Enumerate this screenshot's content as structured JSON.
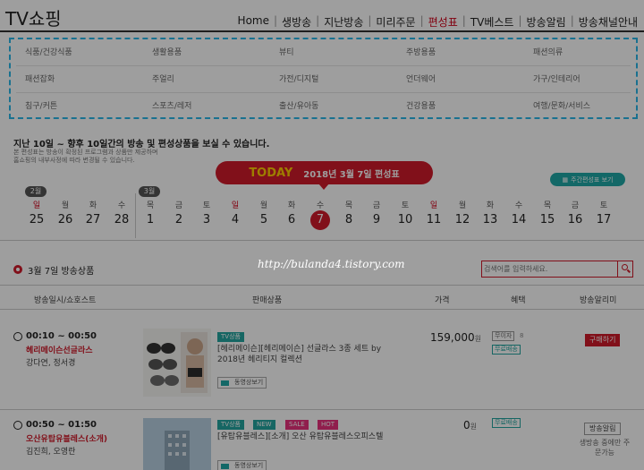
{
  "header": {
    "title": "TV쇼핑",
    "nav": [
      "Home",
      "생방송",
      "지난방송",
      "미리주문",
      "편성표",
      "TV베스트",
      "방송알림",
      "방송채널안내"
    ],
    "active_nav": "편성표"
  },
  "categories": [
    [
      "식품/건강식품",
      "생활용품",
      "뷰티",
      "주방용품",
      "패션의류"
    ],
    [
      "패션잡화",
      "주얼리",
      "가전/디지털",
      "언더웨어",
      "가구/인테리어"
    ],
    [
      "침구/커튼",
      "스포츠/레저",
      "출산/유아동",
      "건강용품",
      "여행/문화/서비스"
    ]
  ],
  "info": {
    "headline": "지난 10일 ~ 향후 10일간의 방송 및 편성상품을 보실 수 있습니다.",
    "note1": "본 편성표는 방송이 확정된 프로그램과 상품만 제공하며",
    "note2": "홈쇼핑의 내부사정에 따라 변경될 수 있습니다."
  },
  "today_banner": {
    "label": "TODAY",
    "date": "2018년 3월 7일 편성표"
  },
  "weekly_button": "주간편성표 보기",
  "calendar": {
    "months": [
      "2월",
      "3월"
    ],
    "days": [
      {
        "dow": "일",
        "num": "25",
        "sun": true
      },
      {
        "dow": "월",
        "num": "26"
      },
      {
        "dow": "화",
        "num": "27"
      },
      {
        "dow": "수",
        "num": "28"
      },
      {
        "dow": "목",
        "num": "1"
      },
      {
        "dow": "금",
        "num": "2"
      },
      {
        "dow": "토",
        "num": "3"
      },
      {
        "dow": "일",
        "num": "4",
        "sun": true
      },
      {
        "dow": "월",
        "num": "5"
      },
      {
        "dow": "화",
        "num": "6"
      },
      {
        "dow": "수",
        "num": "7",
        "selected": true
      },
      {
        "dow": "목",
        "num": "8"
      },
      {
        "dow": "금",
        "num": "9"
      },
      {
        "dow": "토",
        "num": "10"
      },
      {
        "dow": "일",
        "num": "11",
        "sun": true
      },
      {
        "dow": "월",
        "num": "12"
      },
      {
        "dow": "화",
        "num": "13"
      },
      {
        "dow": "수",
        "num": "14"
      },
      {
        "dow": "목",
        "num": "15"
      },
      {
        "dow": "금",
        "num": "16"
      },
      {
        "dow": "토",
        "num": "17"
      }
    ]
  },
  "section": {
    "title": "3월 7일 방송상품",
    "watermark": "http://bulanda4.tistory.com",
    "search_placeholder": "검색어를 입력하세요."
  },
  "table_headers": [
    "방송일시/쇼호스트",
    "판매상품",
    "가격",
    "혜택",
    "방송알리미"
  ],
  "rows": [
    {
      "time": "00:10 ~ 00:50",
      "show": "헤리메이슨선글라스",
      "hosts": "강다연, 정서경",
      "tags": [
        "TV상품"
      ],
      "title_line1": "[헤리메이슨][헤리메이슨] 선글라스 3종 세트 by",
      "title_line2": "2018년 헤리티지 컬렉션",
      "video": "동영상보기",
      "price": "159,000",
      "won": "원",
      "benefit1": "무이자",
      "benefit1_extra": "8",
      "benefit2": "무료배송",
      "action": "구매하기"
    },
    {
      "time": "00:50 ~ 01:50",
      "show": "오산유탑유블레스(소개)",
      "hosts": "김진희, 오영란",
      "tags": [
        "TV상품",
        "NEW",
        "SALE",
        "HOT"
      ],
      "title_line1": "[유탑유블레스][소개] 오산 유탑유블레스오피스텔",
      "video": "동영상보기",
      "price": "0",
      "won": "원",
      "benefit1": "무료배송",
      "action": "방송알림",
      "action_note": "생방송 중에만 주문가능"
    }
  ],
  "colors": {
    "brand_red": "#d11a2a",
    "teal": "#1fa9a6",
    "dashed_border": "#29b6e8"
  }
}
